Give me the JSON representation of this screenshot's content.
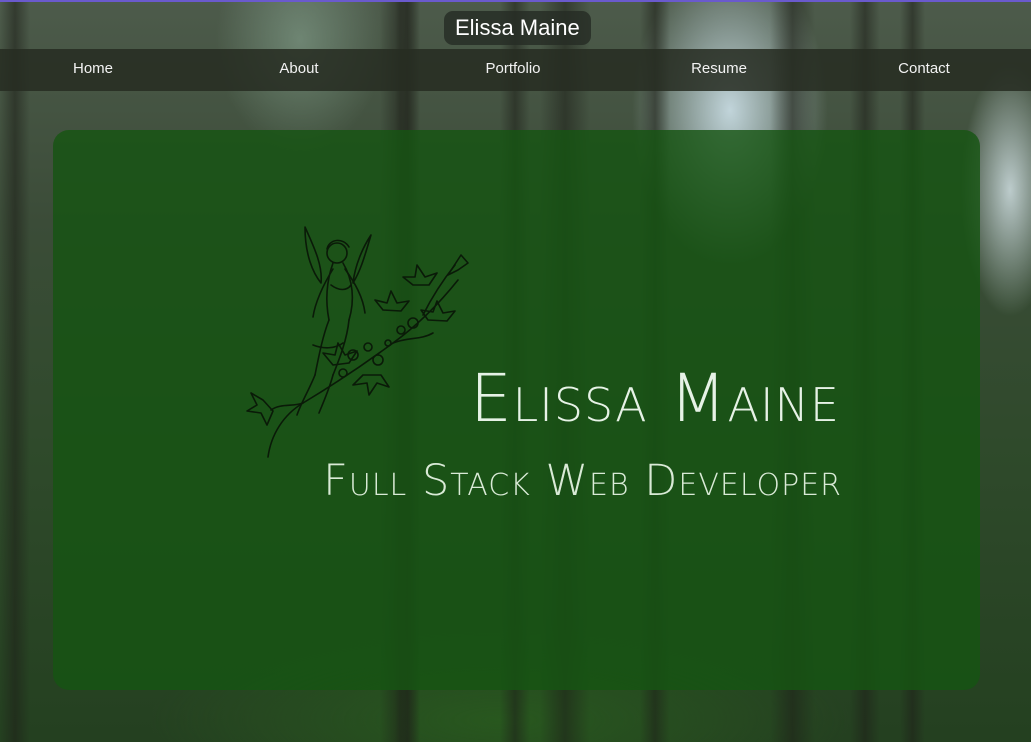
{
  "header": {
    "title": "Elissa Maine"
  },
  "nav": {
    "items": [
      {
        "label": "Home"
      },
      {
        "label": "About"
      },
      {
        "label": "Portfolio"
      },
      {
        "label": "Resume"
      },
      {
        "label": "Contact"
      }
    ]
  },
  "hero": {
    "name": "Elissa Maine",
    "subtitle": "Full Stack Web Developer",
    "illustration": "fairy-on-branch"
  },
  "colors": {
    "card": "#165412",
    "nav_bar": "#262c22",
    "text": "#e6f2e6",
    "top_border": "#6a5acd"
  }
}
